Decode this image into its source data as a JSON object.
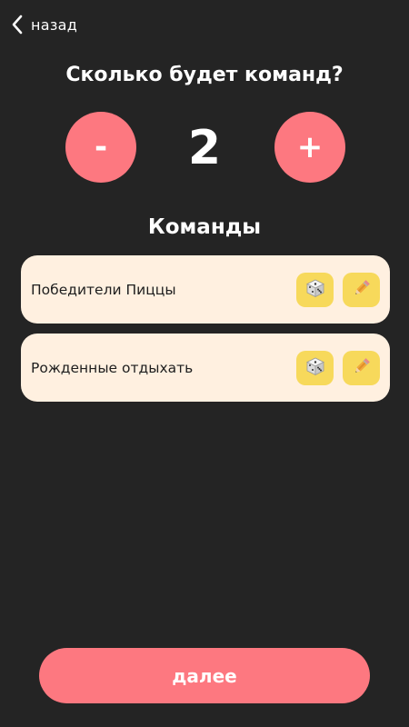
{
  "nav": {
    "back_label": "назад",
    "back_icon": "chevron-left-icon"
  },
  "question": "Сколько будет команд?",
  "counter": {
    "minus_label": "-",
    "value": "2",
    "plus_label": "+"
  },
  "teams_section": {
    "title": "Команды",
    "teams": [
      {
        "name": "Победители Пиццы",
        "random_icon": "dice-icon",
        "edit_icon": "pencil-icon"
      },
      {
        "name": "Рожденные отдыхать",
        "random_icon": "dice-icon",
        "edit_icon": "pencil-icon"
      }
    ]
  },
  "next_button": "далее",
  "colors": {
    "background": "#242424",
    "accent": "#fd7880",
    "card": "#fff0e0",
    "icon_button": "#f7d95b"
  }
}
